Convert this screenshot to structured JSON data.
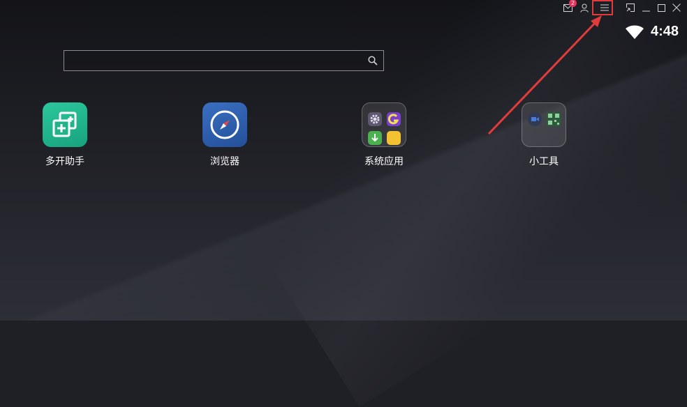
{
  "topbar": {
    "mail_badge": "2",
    "icons": [
      "mail-icon",
      "user-icon",
      "menu-icon",
      "shrink-icon",
      "minimize-icon",
      "maximize-icon",
      "close-icon"
    ]
  },
  "status": {
    "time": "4:48",
    "wifi_icon": "wifi-icon"
  },
  "search": {
    "value": "",
    "placeholder": ""
  },
  "apps": [
    {
      "label": "多开助手",
      "icon": "multi-open-icon",
      "color": "#1fb489"
    },
    {
      "label": "浏览器",
      "icon": "compass-icon",
      "color": "#2d5ea8"
    },
    {
      "label": "系统应用",
      "icon": "folder-icon"
    },
    {
      "label": "小工具",
      "icon": "folder-icon"
    }
  ],
  "colors": {
    "highlight": "#e23b3b",
    "badge": "#e8315a"
  }
}
